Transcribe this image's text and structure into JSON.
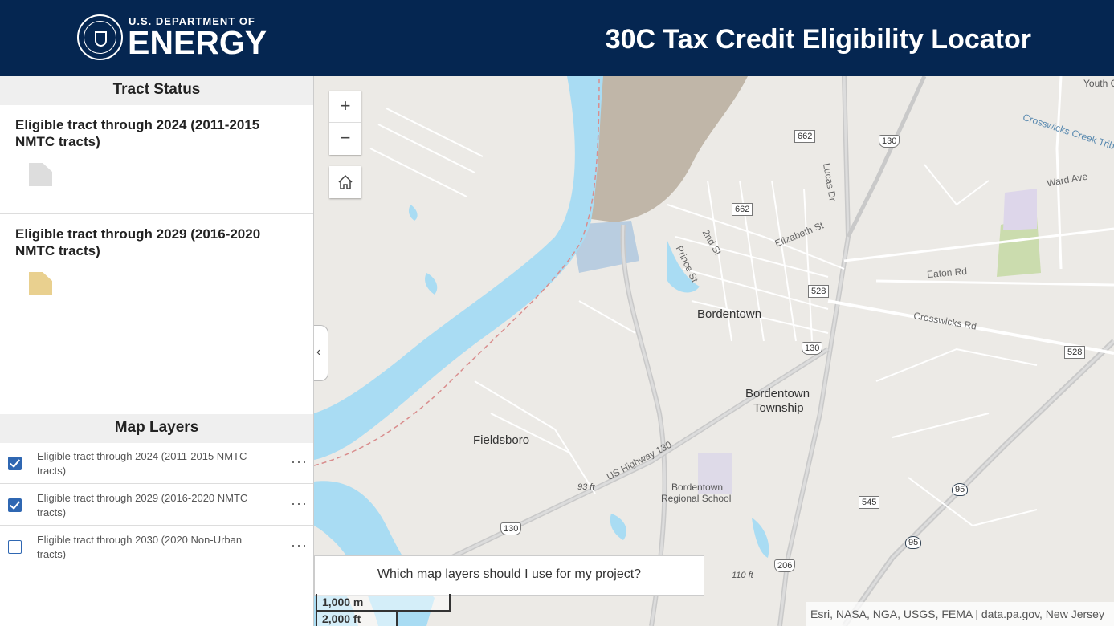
{
  "header": {
    "org_top": "U.S. DEPARTMENT OF",
    "org_main": "ENERGY",
    "app_title": "30C Tax Credit Eligibility Locator",
    "background": "#052651"
  },
  "tract_status": {
    "title": "Tract Status",
    "items": [
      {
        "label": "Eligible tract through 2024 (2011-2015 NMTC tracts)",
        "color": "#dddddd"
      },
      {
        "label": "Eligible tract through 2029 (2016-2020 NMTC tracts)",
        "color": "#e9d08f"
      }
    ]
  },
  "map_layers": {
    "title": "Map Layers",
    "items": [
      {
        "label": "Eligible tract through 2024 (2011-2015 NMTC tracts)",
        "checked": true
      },
      {
        "label": "Eligible tract through 2029 (2016-2020 NMTC tracts)",
        "checked": true
      },
      {
        "label": "Eligible tract through 2030 (2020 Non-Urban tracts)",
        "checked": false
      }
    ],
    "more_icon": "···"
  },
  "map": {
    "zoom_in": "+",
    "zoom_out": "−",
    "home_icon": "home-icon",
    "collapse_icon": "chevron-left-icon",
    "question": "Which map layers should I use for my project?",
    "scale_metric": "1,000 m",
    "scale_imperial": "2,000 ft",
    "attribution": "Esri, NASA, NGA, USGS, FEMA | data.pa.gov, New Jersey",
    "labels": {
      "youth": "Youth C",
      "crosswicks_creek": "Crosswicks Creek Trib",
      "ward_ave": "Ward Ave",
      "lucas_dr": "Lucas Dr",
      "second_st": "2nd St",
      "elizabeth_st": "Elizabeth St",
      "prince_st": "Prince St",
      "eaton_rd": "Eaton Rd",
      "bordentown": "Bordentown",
      "crosswicks_rd": "Crosswicks Rd",
      "bordentown_township_1": "Bordentown",
      "bordentown_township_2": "Township",
      "fieldsboro": "Fieldsboro",
      "us_highway_130": "US Highway 130",
      "elev_93": "93 ft",
      "school_1": "Bordentown",
      "school_2": "Regional School",
      "elev_110": "110 ft",
      "highway_partial": "ghway"
    },
    "shields": {
      "r662a": "662",
      "r130a": "130",
      "r662b": "662",
      "r528a": "528",
      "r130b": "130",
      "r528b": "528",
      "r545": "545",
      "i95a": "95",
      "i95b": "95",
      "r130c": "130",
      "r206": "206"
    },
    "colors": {
      "water": "#a9dcf3",
      "land": "#eceae6",
      "road": "#ffffff",
      "highway": "#c9c9c9",
      "quarry": "#c0b6a8"
    }
  }
}
